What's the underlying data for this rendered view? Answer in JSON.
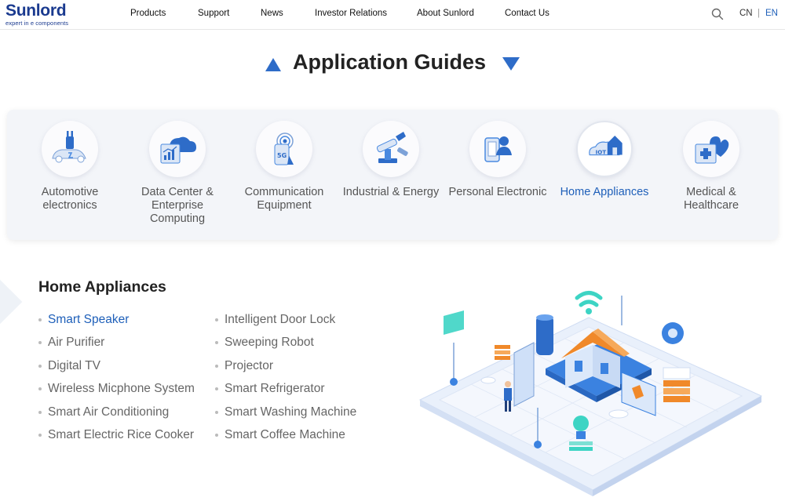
{
  "header": {
    "logo_main": "Sunlord",
    "logo_sub": "expert in e components",
    "nav": [
      "Products",
      "Support",
      "News",
      "Investor Relations",
      "About Sunlord",
      "Contact Us"
    ],
    "lang_cn": "CN",
    "lang_sep": "|",
    "lang_en": "EN",
    "search_icon": "search-icon"
  },
  "page_title": "Application Guides",
  "categories": [
    {
      "label": "Automotive\nelectronics",
      "icon": "car-plug-icon"
    },
    {
      "label": "Data Center &\nEnterprise\nComputing",
      "icon": "cloud-chart-icon"
    },
    {
      "label": "Communication\nEquipment",
      "icon": "5g-signal-icon"
    },
    {
      "label": "Industrial & Energy",
      "icon": "robot-arm-icon"
    },
    {
      "label": "Personal Electronic",
      "icon": "phone-user-icon"
    },
    {
      "label": "Home Appliances",
      "icon": "iot-home-icon"
    },
    {
      "label": "Medical &\nHealthcare",
      "icon": "medical-heart-icon"
    }
  ],
  "active_category": "Home Appliances",
  "section_title": "Home Appliances",
  "apps_col1": [
    "Smart Speaker",
    "Air Purifier",
    "Digital TV",
    "Wireless Micphone System",
    "Smart Air Conditioning",
    "Smart Electric Rice Cooker"
  ],
  "apps_col2": [
    "Intelligent Door Lock",
    "Sweeping Robot",
    "Projector",
    "Smart Refrigerator",
    "Smart Washing Machine",
    "Smart Coffee Machine"
  ],
  "active_app": "Smart Speaker",
  "colors": {
    "brand": "#1a3a8f",
    "accent": "#2e6cc8",
    "active_text": "#1e5fb9",
    "orange": "#f0892a"
  }
}
